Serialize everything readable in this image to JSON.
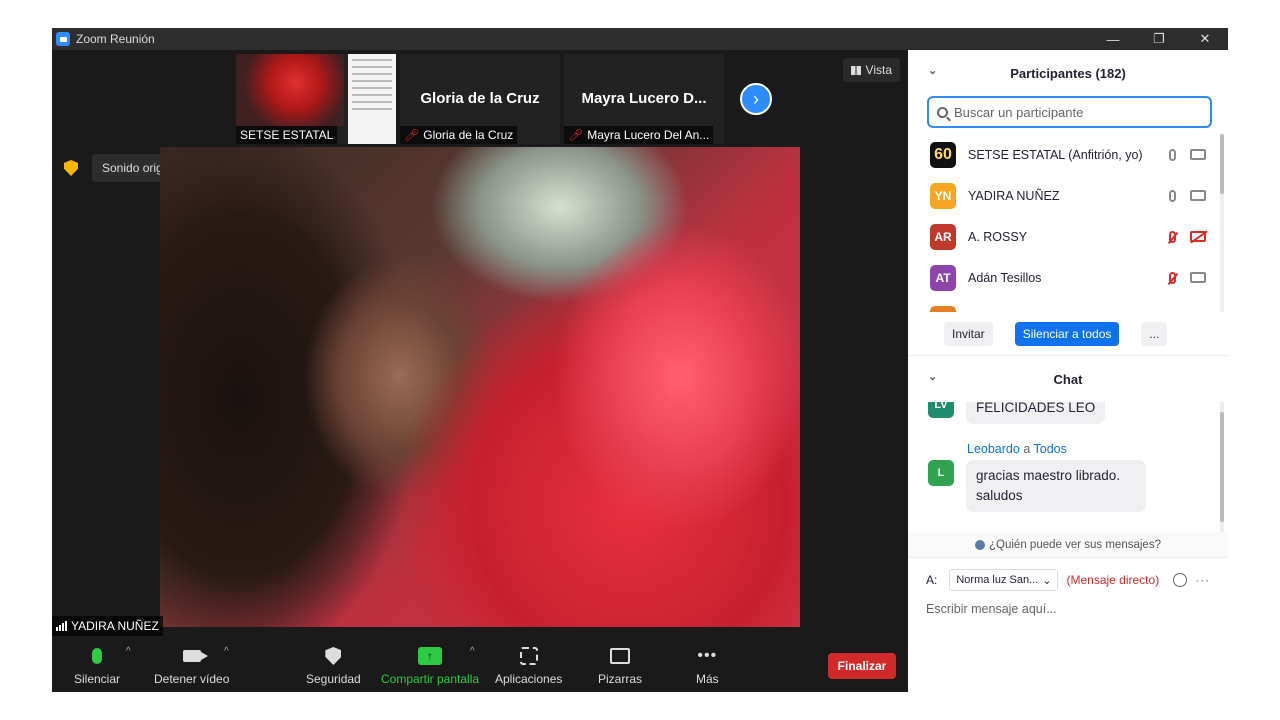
{
  "titlebar": {
    "title": "Zoom Reunión",
    "minimize": "—",
    "restore": "❐",
    "close": "✕"
  },
  "thumbnails": [
    {
      "name": "SETSE ESTATAL"
    },
    {
      "big_name": "Gloria de la Cruz",
      "name": "Gloria de la Cruz",
      "muted": true
    },
    {
      "big_name": "Mayra  Lucero  D...",
      "name": "Mayra Lucero Del An...",
      "muted": true
    }
  ],
  "next_icon": "›",
  "vista_label": "Vista",
  "sonido": {
    "label": "Sonido original: desactivado",
    "dropdown": "▾"
  },
  "speaker_name": "YADIRA NUÑEZ",
  "toolbar": {
    "silenciar": "Silenciar",
    "detener_video": "Detener vídeo",
    "seguridad": "Seguridad",
    "compartir": "Compartir pantalla",
    "aplicaciones": "Aplicaciones",
    "pizarras": "Pizarras",
    "mas": "Más",
    "finalizar": "Finalizar",
    "caret": "^",
    "share_arrow": "↑",
    "more_dots": "•••"
  },
  "participants": {
    "header": "Participantes (182)",
    "search_placeholder": "Buscar un participante",
    "list": [
      {
        "initials": "60",
        "name": "SETSE ESTATAL (Anfitrión, yo)",
        "color": "#111111",
        "mic_off": false,
        "cam_off": false
      },
      {
        "initials": "YN",
        "name": "YADIRA NUÑEZ",
        "color": "#f5a623",
        "mic_off": false,
        "cam_off": false
      },
      {
        "initials": "AR",
        "name": "A. ROSSY",
        "color": "#c0392b",
        "mic_off": true,
        "cam_off": true
      },
      {
        "initials": "AT",
        "name": "Adán Tesillos",
        "color": "#8e44ad",
        "mic_off": true,
        "cam_off": false
      }
    ],
    "buttons": {
      "invite": "Invitar",
      "mute_all": "Silenciar a todos",
      "more": "..."
    }
  },
  "chat": {
    "header": "Chat",
    "messages": [
      {
        "avatar": "LV",
        "text": "FELICIDADES LEO"
      },
      {
        "sender": "Leobardo",
        "to_word": "a",
        "recipient": "Todos",
        "avatar": "L",
        "text": "gracias maestro librado. saludos"
      }
    ],
    "who_can_see": "¿Quién puede ver sus mensajes?",
    "to_label": "A:",
    "to_value": "Norma luz San...",
    "to_caret": "⌄",
    "direct": "(Mensaje directo)",
    "more": "···",
    "compose_placeholder": "Escribir mensaje aquí..."
  },
  "colors": {
    "accent": "#2d8cff",
    "danger": "#d02a2a",
    "green": "#2ecc40"
  }
}
